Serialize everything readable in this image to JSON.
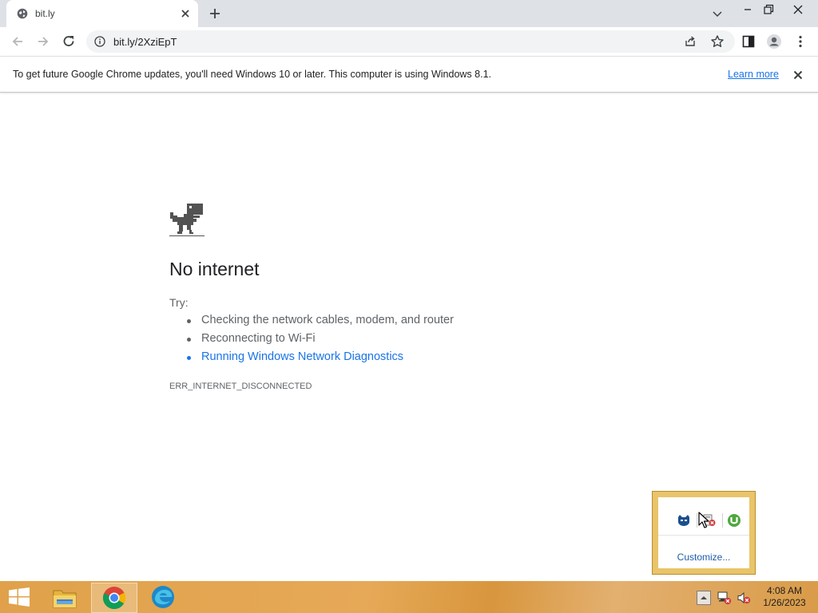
{
  "browser": {
    "tab_title": "bit.ly",
    "url": "bit.ly/2XziEpT",
    "infobar": {
      "message": "To get future Google Chrome updates, you'll need Windows 10 or later. This computer is using Windows 8.1.",
      "link": "Learn more"
    }
  },
  "error_page": {
    "heading": "No internet",
    "try_label": "Try:",
    "suggestions": [
      "Checking the network cables, modem, and router",
      "Reconnecting to Wi-Fi",
      "Running Windows Network Diagnostics"
    ],
    "error_code": "ERR_INTERNET_DISCONNECTED"
  },
  "overflow_popup": {
    "icons": [
      "bitdefender-icon",
      "network-flag-icon",
      "utorrent-icon"
    ],
    "customize_label": "Customize..."
  },
  "taskbar": {
    "apps": [
      "file-explorer-icon",
      "chrome-icon",
      "edge-icon"
    ],
    "tray_icons": [
      "show-hidden-icons-icon",
      "network-disconnected-icon",
      "volume-muted-icon"
    ],
    "time": "4:08 AM",
    "date": "1/26/2023"
  },
  "colors": {
    "link_blue": "#1a73e8",
    "taskbar": "#e0a14a",
    "popup_border": "#e9c46a"
  }
}
